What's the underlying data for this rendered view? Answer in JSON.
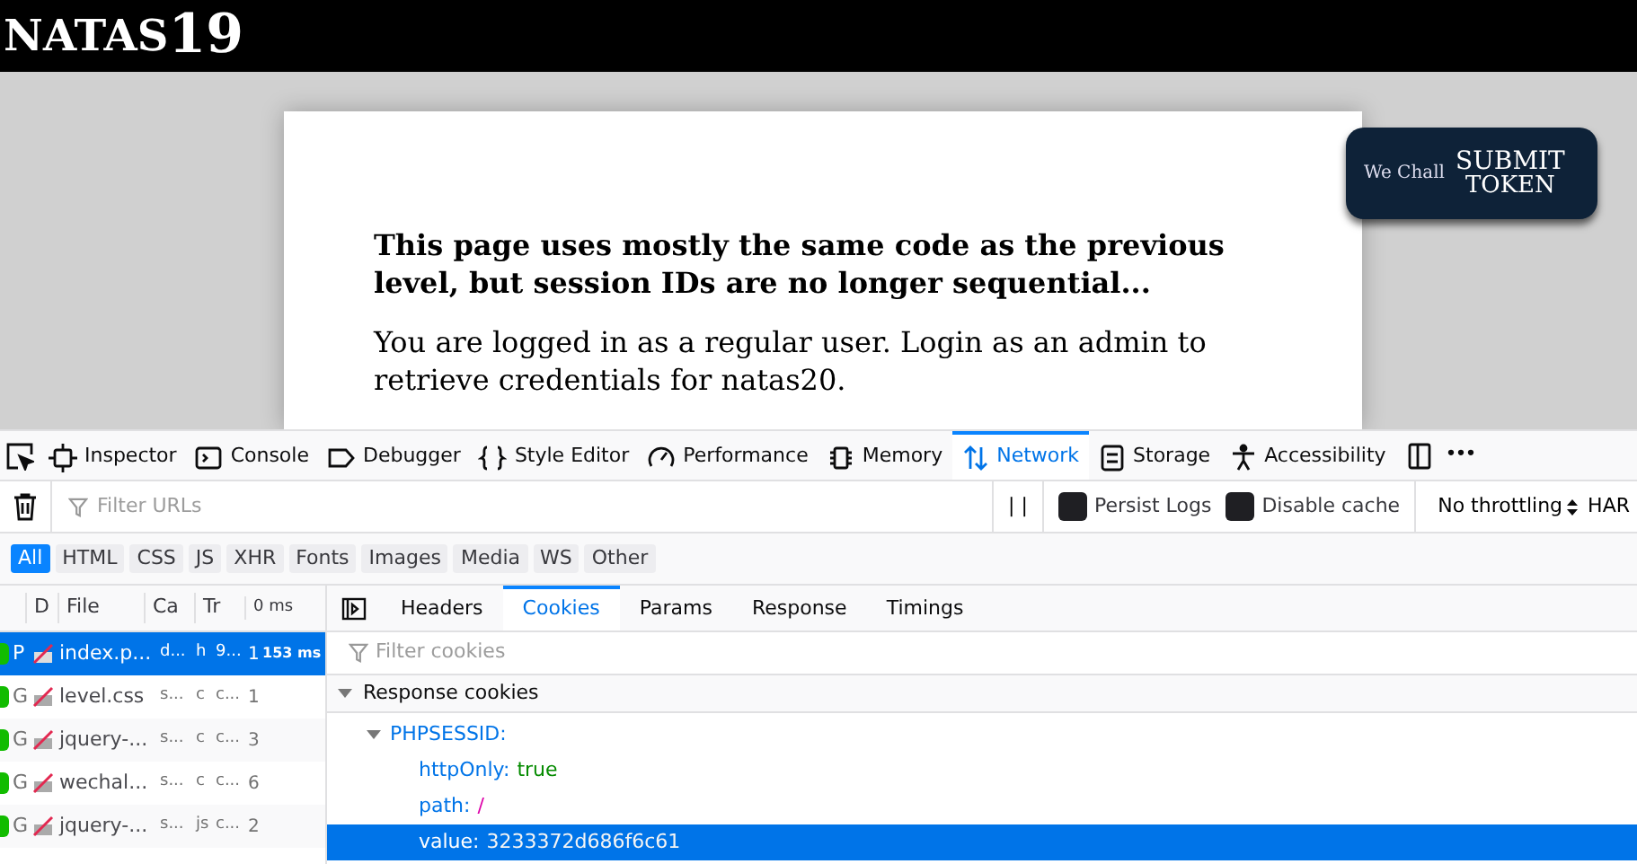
{
  "site": {
    "title": "NATAS",
    "level": "19",
    "token_button": {
      "logo": "We Chall",
      "line1": "SUBMIT",
      "line2": "TOKEN"
    }
  },
  "content": {
    "heading": "This page uses mostly the same code as the previous level, but session IDs are no longer sequential...",
    "text": "You are logged in as a regular user. Login as an admin to retrieve credentials for natas20."
  },
  "devtools": {
    "tabs": [
      {
        "label": "Inspector",
        "selected": false
      },
      {
        "label": "Console",
        "selected": false
      },
      {
        "label": "Debugger",
        "selected": false
      },
      {
        "label": "Style Editor",
        "selected": false
      },
      {
        "label": "Performance",
        "selected": false
      },
      {
        "label": "Memory",
        "selected": false
      },
      {
        "label": "Network",
        "selected": true
      },
      {
        "label": "Storage",
        "selected": false
      },
      {
        "label": "Accessibility",
        "selected": false
      }
    ],
    "more": "•••",
    "filter": {
      "placeholder": "Filter URLs"
    },
    "pause": "| |",
    "options": [
      {
        "label": "Persist Logs",
        "checked": false
      },
      {
        "label": "Disable cache",
        "checked": false
      }
    ],
    "throttling": "No throttling",
    "har": "HAR",
    "types": [
      {
        "label": "All",
        "selected": true
      },
      {
        "label": "HTML",
        "selected": false
      },
      {
        "label": "CSS",
        "selected": false
      },
      {
        "label": "JS",
        "selected": false
      },
      {
        "label": "XHR",
        "selected": false
      },
      {
        "label": "Fonts",
        "selected": false
      },
      {
        "label": "Images",
        "selected": false
      },
      {
        "label": "Media",
        "selected": false
      },
      {
        "label": "WS",
        "selected": false
      },
      {
        "label": "Other",
        "selected": false
      }
    ],
    "columns": [
      "D",
      "File",
      "Ca",
      "Tr",
      "0 ms"
    ],
    "requests": [
      {
        "method": "P",
        "file": "index.p...",
        "cause": "d...",
        "type": "h",
        "transferred": "9...",
        "size": "1",
        "time": "153 ms",
        "selected": true
      },
      {
        "method": "G",
        "file": "level.css",
        "cause": "s...",
        "type": "c",
        "transferred": "c...",
        "size": "1",
        "selected": false
      },
      {
        "method": "G",
        "file": "jquery-...",
        "cause": "s...",
        "type": "c",
        "transferred": "c...",
        "size": "3",
        "selected": false
      },
      {
        "method": "G",
        "file": "wechal...",
        "cause": "s...",
        "type": "c",
        "transferred": "c...",
        "size": "6",
        "selected": false
      },
      {
        "method": "G",
        "file": "jquery-...",
        "cause": "s...",
        "type": "js",
        "transferred": "c...",
        "size": "2",
        "selected": false
      }
    ],
    "detail_tabs": [
      {
        "label": "Headers",
        "selected": false
      },
      {
        "label": "Cookies",
        "selected": true
      },
      {
        "label": "Params",
        "selected": false
      },
      {
        "label": "Response",
        "selected": false
      },
      {
        "label": "Timings",
        "selected": false
      }
    ],
    "cookie_filter": {
      "placeholder": "Filter cookies"
    },
    "cookies": {
      "section": "Response cookies",
      "expanded": true,
      "name": "PHPSESSID:",
      "name_expanded": true,
      "props": [
        {
          "key": "httpOnly:",
          "value": "true",
          "kind": "bool",
          "selected": false
        },
        {
          "key": "path:",
          "value": "/",
          "kind": "string",
          "selected": false
        },
        {
          "key": "value:",
          "value": "3233372d686f6c61",
          "kind": "plain",
          "selected": true
        }
      ]
    }
  }
}
